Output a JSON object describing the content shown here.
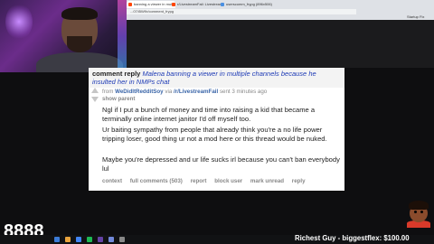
{
  "browser": {
    "tabs": [
      {
        "label": "banning a viewer in multi",
        "color": "#ff4500"
      },
      {
        "label": "r/LivestreamFail: Livestream",
        "color": "#ff4500"
      },
      {
        "label": "userscomm_frypg (896x506)",
        "color": "#4a90e2"
      }
    ],
    "address": "...07/i5Wf/r/comment_frypg",
    "bookmark": "Startup Fix"
  },
  "comment": {
    "header_label": "comment reply",
    "post_title_line1": "Malena banning a viewer in multiple channels because he",
    "post_title_line2": "insulted her in NMPs chat",
    "from_label": "from",
    "author": "WeDidItRedditSoy",
    "via_label": "via",
    "subreddit": "/r/LivestreamFail",
    "sent_label": "sent 3 minutes ago",
    "show_parent": "show parent",
    "paragraphs": [
      "Ngl if I put a bunch of money and time into raising a kid that became a terminally online internet janitor I'd off myself too.",
      "Ur baiting sympathy from people that already think you're a no life power tripping loser, good thing ur not a mod here or this thread would be nuked.",
      "Maybe you're depressed and ur life sucks irl because you can't ban everybody lul"
    ],
    "actions": [
      "context",
      "full comments (503)",
      "report",
      "block user",
      "mark unread",
      "reply"
    ]
  },
  "overlay": {
    "counter": "8888",
    "ticker": "Richest Guy - biggestflex: $100.00"
  },
  "colors": {
    "link_blue": "#1d3ab5",
    "author_blue": "#3a65a8",
    "background": "#0e0e10"
  }
}
